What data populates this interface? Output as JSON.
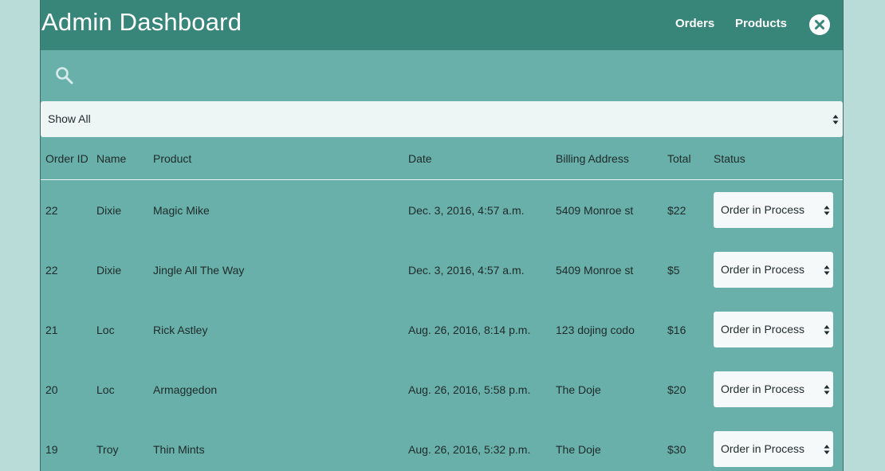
{
  "header": {
    "title": "Admin Dashboard",
    "nav": [
      {
        "label": "Orders"
      },
      {
        "label": "Products"
      }
    ],
    "close_icon": "close-circle-icon"
  },
  "search": {
    "icon": "search-icon"
  },
  "filter": {
    "selected": "Show All"
  },
  "colors": {
    "topbar": "#38857a",
    "panel": "#68b0a9",
    "background": "#b9dcd9"
  },
  "table": {
    "columns": [
      "Order ID",
      "Name",
      "Product",
      "Date",
      "Billing Address",
      "Total",
      "Status"
    ],
    "rows": [
      {
        "order_id": "22",
        "name": "Dixie",
        "product": "Magic Mike",
        "date": "Dec. 3, 2016, 4:57 a.m.",
        "address": "5409 Monroe st",
        "total": "$22",
        "status": "Order in Process"
      },
      {
        "order_id": "22",
        "name": "Dixie",
        "product": "Jingle All The Way",
        "date": "Dec. 3, 2016, 4:57 a.m.",
        "address": "5409 Monroe st",
        "total": "$5",
        "status": "Order in Process"
      },
      {
        "order_id": "21",
        "name": "Loc",
        "product": "Rick Astley",
        "date": "Aug. 26, 2016, 8:14 p.m.",
        "address": "123 dojing codo",
        "total": "$16",
        "status": "Order in Process"
      },
      {
        "order_id": "20",
        "name": "Loc",
        "product": "Armaggedon",
        "date": "Aug. 26, 2016, 5:58 p.m.",
        "address": "The Doje",
        "total": "$20",
        "status": "Order in Process"
      },
      {
        "order_id": "19",
        "name": "Troy",
        "product": "Thin Mints",
        "date": "Aug. 26, 2016, 5:32 p.m.",
        "address": "The Doje",
        "total": "$30",
        "status": "Order in Process"
      }
    ]
  }
}
